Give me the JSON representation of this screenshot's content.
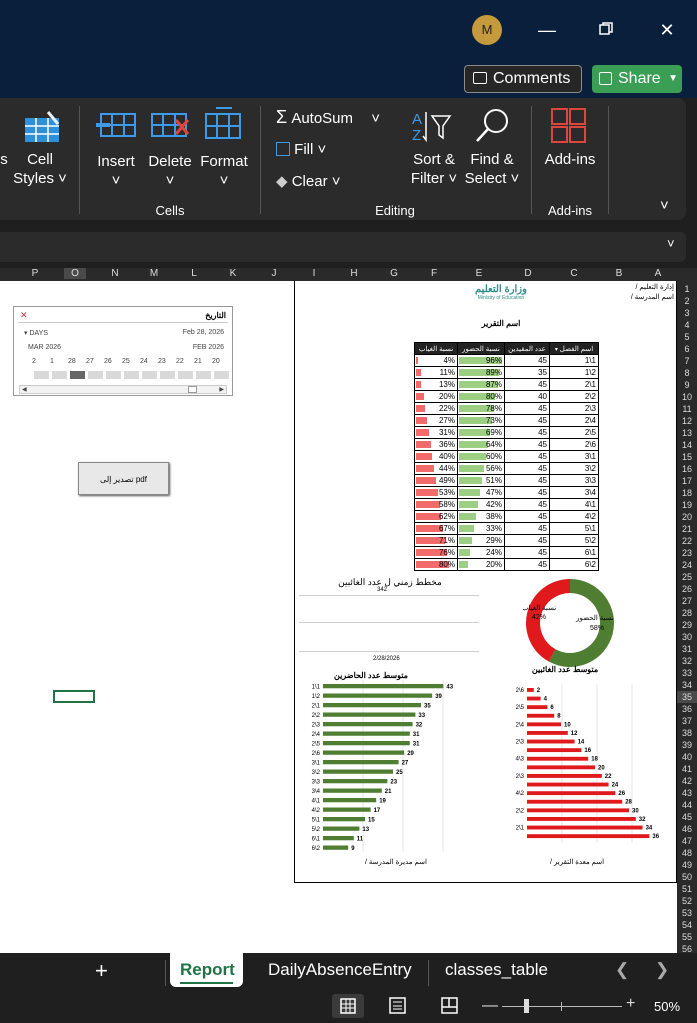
{
  "titlebar": {
    "avatar_initial": "M"
  },
  "actions": {
    "comments": "Comments",
    "share": "Share"
  },
  "ribbon": {
    "cell_styles_l1": "Cell",
    "cell_styles_l2": "Styles",
    "truncated": "s",
    "insert": "Insert",
    "delete": "Delete",
    "format": "Format",
    "cells_group": "Cells",
    "autosum": "AutoSum",
    "fill": "Fill",
    "clear": "Clear",
    "sort_l1": "Sort &",
    "sort_l2": "Filter",
    "find_l1": "Find &",
    "find_l2": "Select",
    "editing_group": "Editing",
    "addins": "Add-ins",
    "addins_group": "Add-ins"
  },
  "columns": [
    "P",
    "O",
    "N",
    "M",
    "L",
    "K",
    "J",
    "I",
    "H",
    "G",
    "F",
    "E",
    "D",
    "C",
    "B",
    "A"
  ],
  "rows": [
    "1",
    "2",
    "3",
    "4",
    "5",
    "6",
    "7",
    "8",
    "9",
    "10",
    "11",
    "12",
    "13",
    "14",
    "15",
    "16",
    "17",
    "18",
    "19",
    "20",
    "21",
    "22",
    "23",
    "24",
    "25",
    "26",
    "27",
    "28",
    "29",
    "30",
    "31",
    "32",
    "33",
    "34",
    "35",
    "36",
    "37",
    "38",
    "39",
    "40",
    "41",
    "42",
    "43",
    "44",
    "45",
    "46",
    "47",
    "48",
    "49",
    "50",
    "51",
    "52",
    "53",
    "54",
    "55",
    "56"
  ],
  "report": {
    "admin_label": "إدارة التعليم /",
    "school_label": "اسم المدرسة /",
    "logo_text": "وزارة التعليم",
    "logo_sub": "Ministry of Education",
    "report_name": "اسم التقرير",
    "table_headers": [
      "اسم الفصل",
      "عدد المقيدين",
      "نسبة الحضور",
      "نسبة الغياب"
    ],
    "rows": [
      {
        "cls": "1\\1",
        "enrolled": "45",
        "att": 96,
        "abs": 4
      },
      {
        "cls": "1\\2",
        "enrolled": "35",
        "att": 89,
        "abs": 11
      },
      {
        "cls": "2\\1",
        "enrolled": "45",
        "att": 87,
        "abs": 13
      },
      {
        "cls": "2\\2",
        "enrolled": "40",
        "att": 80,
        "abs": 20
      },
      {
        "cls": "2\\3",
        "enrolled": "45",
        "att": 78,
        "abs": 22
      },
      {
        "cls": "2\\4",
        "enrolled": "45",
        "att": 73,
        "abs": 27
      },
      {
        "cls": "2\\5",
        "enrolled": "45",
        "att": 69,
        "abs": 31
      },
      {
        "cls": "2\\6",
        "enrolled": "45",
        "att": 64,
        "abs": 36
      },
      {
        "cls": "3\\1",
        "enrolled": "45",
        "att": 60,
        "abs": 40
      },
      {
        "cls": "3\\2",
        "enrolled": "45",
        "att": 56,
        "abs": 44
      },
      {
        "cls": "3\\3",
        "enrolled": "45",
        "att": 51,
        "abs": 49
      },
      {
        "cls": "3\\4",
        "enrolled": "45",
        "att": 47,
        "abs": 53
      },
      {
        "cls": "4\\1",
        "enrolled": "45",
        "att": 42,
        "abs": 58
      },
      {
        "cls": "4\\2",
        "enrolled": "45",
        "att": 38,
        "abs": 62
      },
      {
        "cls": "5\\1",
        "enrolled": "45",
        "att": 33,
        "abs": 67
      },
      {
        "cls": "5\\2",
        "enrolled": "45",
        "att": 29,
        "abs": 71
      },
      {
        "cls": "6\\1",
        "enrolled": "45",
        "att": 24,
        "abs": 76
      },
      {
        "cls": "6\\2",
        "enrolled": "45",
        "att": 20,
        "abs": 80
      }
    ],
    "timeline_title": "مخطط زمني ل عدد الغائبين",
    "timeline_value": "342",
    "timeline_date": "2/28/2026",
    "footer_left": "اسم مديرة المدرسة /",
    "footer_right": "اسم معدة التقرير /"
  },
  "chart_data": [
    {
      "type": "pie",
      "categories": [
        "نسبة الحضور",
        "نسبة الغياب"
      ],
      "values": [
        58,
        42
      ],
      "labels": [
        "نسبة الحضور 58%",
        "نسبة الغياب 42%"
      ],
      "colors": [
        "#4f7d32",
        "#e0191c"
      ]
    },
    {
      "type": "bar",
      "title": "متوسط عدد الحاضرين",
      "categories": [
        "1\\1",
        "1\\2",
        "2\\1",
        "2\\2",
        "2\\3",
        "2\\4",
        "2\\5",
        "2\\6",
        "3\\1",
        "3\\2",
        "3\\3",
        "3\\4",
        "4\\1",
        "4\\2",
        "5\\1",
        "5\\2",
        "6\\1",
        "6\\2"
      ],
      "values": [
        43,
        39,
        35,
        33,
        32,
        31,
        31,
        29,
        27,
        25,
        23,
        21,
        19,
        17,
        15,
        13,
        11,
        9
      ],
      "color": "#4f7d32"
    },
    {
      "type": "bar",
      "title": "متوسط عدد الغائبين",
      "categories": [
        "1\\1",
        "1\\2",
        "2\\1",
        "2\\2",
        "2\\3",
        "2\\4",
        "2\\5",
        "2\\6",
        "3\\1",
        "3\\2",
        "3\\3",
        "3\\4",
        "4\\1",
        "4\\2",
        "5\\1",
        "5\\2",
        "6\\1",
        "6\\2"
      ],
      "values": [
        2,
        4,
        6,
        8,
        10,
        12,
        14,
        16,
        18,
        20,
        22,
        24,
        26,
        28,
        30,
        32,
        34,
        36
      ],
      "tick_labels": [
        "2\\6",
        "",
        "2\\5",
        "",
        "2\\4",
        "",
        "2\\3",
        "",
        "4\\3",
        "",
        "2\\3",
        "",
        "4\\2",
        "",
        "2\\2",
        "",
        "2\\1",
        ""
      ],
      "color": "#e0191c"
    }
  ],
  "slicer": {
    "title": "التاريخ",
    "days_label": "DAYS",
    "range_label": "Feb 28, 2026",
    "month_left": "MAR 2026",
    "month_right": "FEB 2026",
    "days": [
      "2",
      "1",
      "28",
      "27",
      "26",
      "25",
      "24",
      "23",
      "22",
      "21",
      "20"
    ]
  },
  "pdf_button": "تصدير إلى pdf",
  "tabs": {
    "add": "+",
    "report": "Report",
    "daily": "DailyAbsenceEntry",
    "classes": "classes_table"
  },
  "status": {
    "zoom": "50%"
  }
}
